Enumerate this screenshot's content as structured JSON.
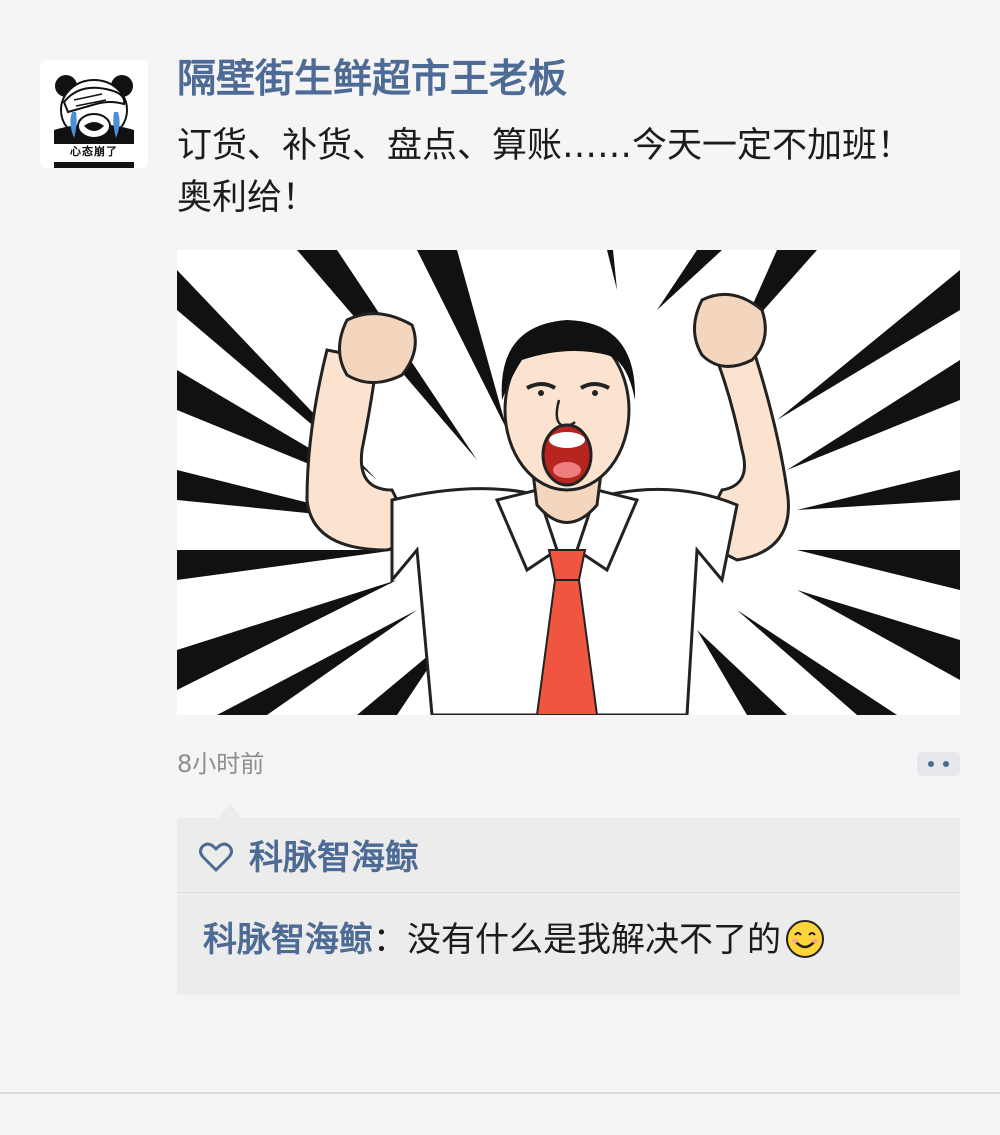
{
  "post": {
    "author_name": "隔壁街生鲜超市王老板",
    "text": "订货、补货、盘点、算账……今天一定不加班！奥利给！",
    "timestamp": "8小时前",
    "avatar": {
      "icon": "crying-panda-meme-icon",
      "caption": "心态崩了"
    },
    "image": {
      "icon": "cheering-office-worker-illustration"
    },
    "more_button_icon": "ellipsis-icon"
  },
  "interactions": {
    "likes": {
      "icon": "heart-outline-icon",
      "names": "科脉智海鲸"
    },
    "comments": [
      {
        "author": "科脉智海鲸",
        "separator": "：",
        "text": "没有什么是我解决不了的",
        "emoji": "smiling-face-icon"
      }
    ]
  },
  "colors": {
    "background": "#f5f5f5",
    "link_blue": "#4d6b95",
    "interaction_bg": "#ececec",
    "timestamp_gray": "#8d8d8d",
    "tie_red": "#f0553f"
  }
}
